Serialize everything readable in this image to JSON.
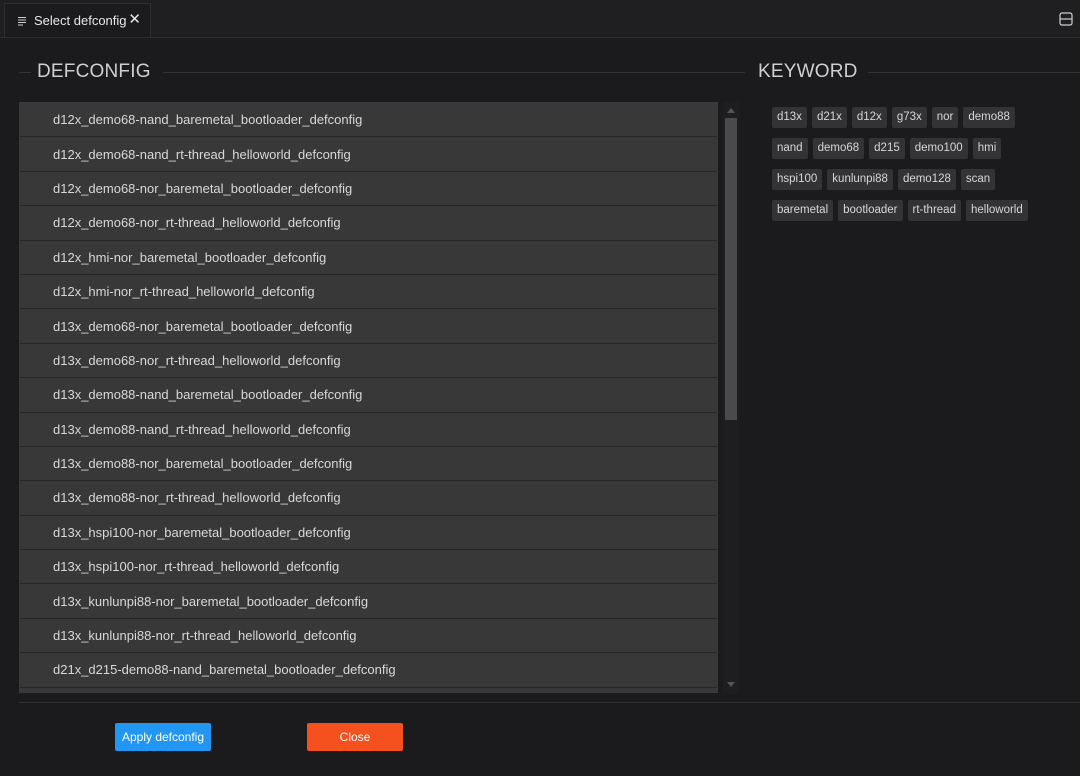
{
  "tab": {
    "title": "Select defconfig",
    "close_glyph": "✕"
  },
  "defconfig": {
    "heading": "DEFCONFIG",
    "items": [
      "d12x_demo68-nand_baremetal_bootloader_defconfig",
      "d12x_demo68-nand_rt-thread_helloworld_defconfig",
      "d12x_demo68-nor_baremetal_bootloader_defconfig",
      "d12x_demo68-nor_rt-thread_helloworld_defconfig",
      "d12x_hmi-nor_baremetal_bootloader_defconfig",
      "d12x_hmi-nor_rt-thread_helloworld_defconfig",
      "d13x_demo68-nor_baremetal_bootloader_defconfig",
      "d13x_demo68-nor_rt-thread_helloworld_defconfig",
      "d13x_demo88-nand_baremetal_bootloader_defconfig",
      "d13x_demo88-nand_rt-thread_helloworld_defconfig",
      "d13x_demo88-nor_baremetal_bootloader_defconfig",
      "d13x_demo88-nor_rt-thread_helloworld_defconfig",
      "d13x_hspi100-nor_baremetal_bootloader_defconfig",
      "d13x_hspi100-nor_rt-thread_helloworld_defconfig",
      "d13x_kunlunpi88-nor_baremetal_bootloader_defconfig",
      "d13x_kunlunpi88-nor_rt-thread_helloworld_defconfig",
      "d21x_d215-demo88-nand_baremetal_bootloader_defconfig",
      ""
    ]
  },
  "keyword": {
    "heading": "KEYWORD",
    "rows": [
      [
        "d13x",
        "d21x",
        "d12x",
        "g73x",
        "nor",
        "demo88"
      ],
      [
        "nand",
        "demo68",
        "d215",
        "demo100",
        "hmi"
      ],
      [
        "hspi100",
        "kunlunpi88",
        "demo128",
        "scan"
      ],
      [
        "baremetal",
        "bootloader",
        "rt-thread",
        "helloworld"
      ]
    ]
  },
  "buttons": {
    "apply": "Apply defconfig",
    "close": "Close"
  },
  "colors": {
    "apply": "#2196f3",
    "close": "#f4511e",
    "background": "#1b1b1d"
  }
}
